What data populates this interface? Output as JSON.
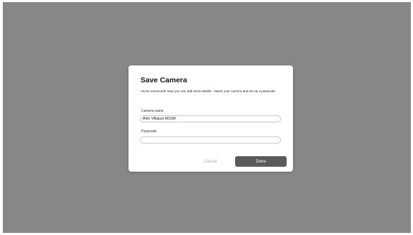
{
  "dialog": {
    "title": "Save Camera",
    "description": "You're connected! Now you can add some details - Name your camera and set up a passcode",
    "camera_name": {
      "label": "Camera name",
      "value": "AVer VBaium M15W"
    },
    "passcode": {
      "label": "Passcode",
      "value": ""
    },
    "cancel_label": "Cancel",
    "done_label": "Done"
  },
  "colors": {
    "backdrop": "#878787",
    "done_button": "#5a5a5a",
    "cancel_text": "#aaaaaa"
  }
}
